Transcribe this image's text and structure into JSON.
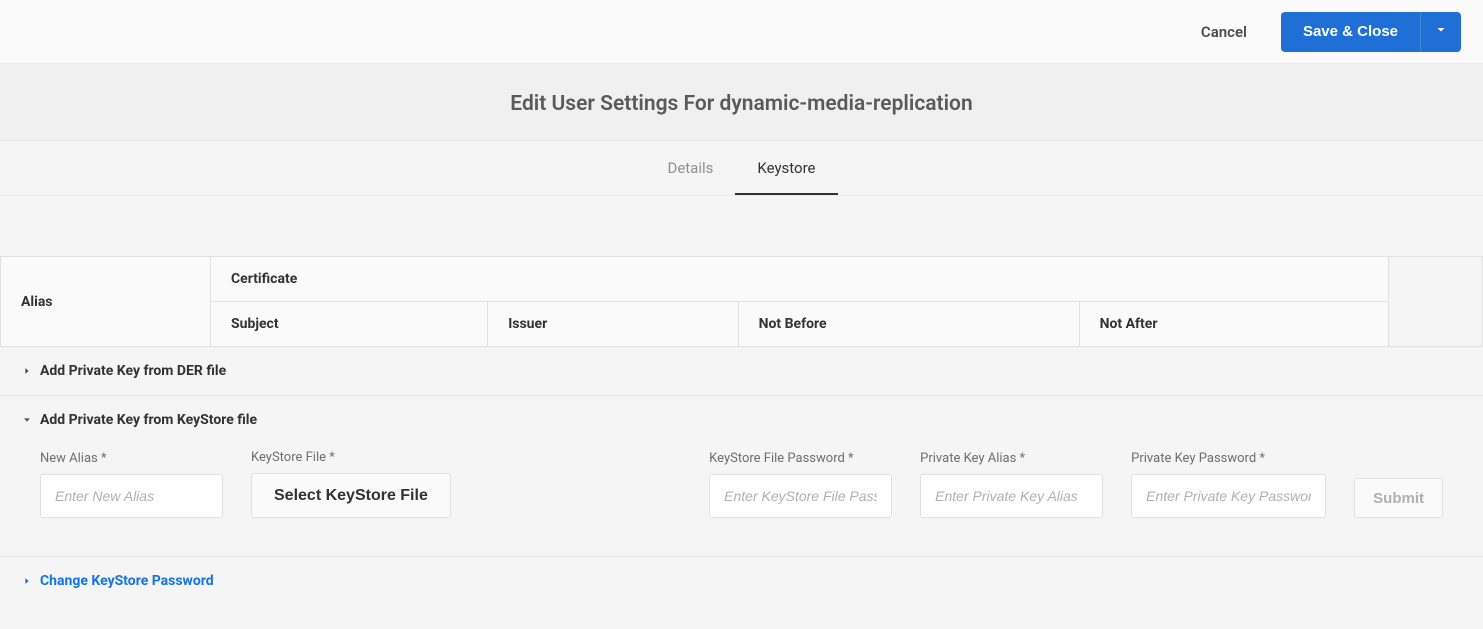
{
  "header": {
    "cancel": "Cancel",
    "save": "Save & Close"
  },
  "page_title": "Edit User Settings For dynamic-media-replication",
  "tabs": {
    "details": "Details",
    "keystore": "Keystore"
  },
  "table": {
    "alias": "Alias",
    "certificate": "Certificate",
    "subject": "Subject",
    "issuer": "Issuer",
    "not_before": "Not Before",
    "not_after": "Not After"
  },
  "accordions": {
    "der": "Add Private Key from DER file",
    "ks": "Add Private Key from KeyStore file",
    "change_pw": "Change KeyStore Password"
  },
  "ks_form": {
    "new_alias_label": "New Alias *",
    "new_alias_placeholder": "Enter New Alias",
    "keystore_file_label": "KeyStore File *",
    "keystore_file_btn": "Select KeyStore File",
    "ks_pw_label": "KeyStore File Password *",
    "ks_pw_placeholder": "Enter KeyStore File Password",
    "pk_alias_label": "Private Key Alias *",
    "pk_alias_placeholder": "Enter Private Key Alias",
    "pk_pw_label": "Private Key Password *",
    "pk_pw_placeholder": "Enter Private Key Password",
    "submit": "Submit"
  }
}
